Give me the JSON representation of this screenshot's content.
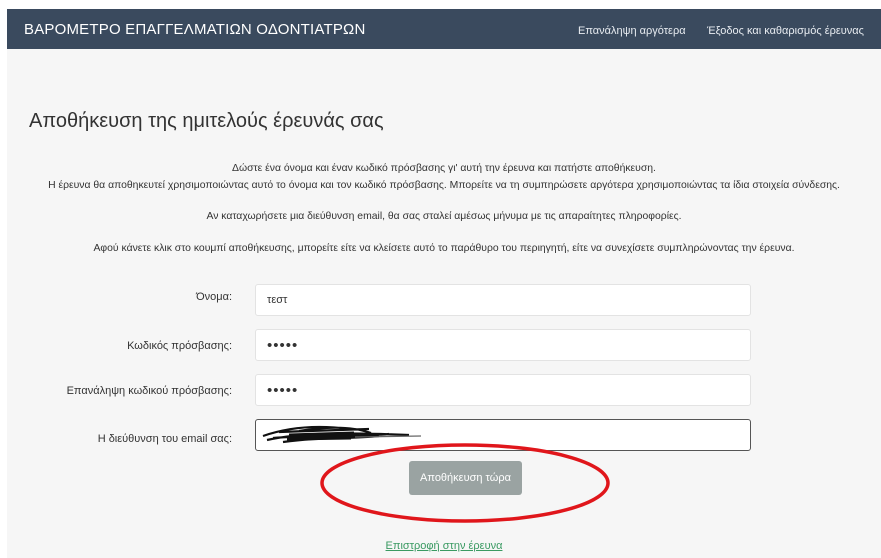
{
  "header": {
    "title": "ΒΑΡΟΜΕΤΡΟ ΕΠΑΓΓΕΛΜΑΤΙΩΝ ΟΔΟΝΤΙΑΤΡΩΝ",
    "resume_later": "Επανάληψη αργότερα",
    "exit_clear": "Έξοδος και καθαρισμός έρευνας"
  },
  "page": {
    "title": "Αποθήκευση της ημιτελούς έρευνάς σας",
    "intro": [
      "Δώστε ένα όνομα και έναν κωδικό πρόσβασης γι' αυτή την έρευνα και πατήστε αποθήκευση.",
      "Η έρευνα θα αποθηκευτεί χρησιμοποιώντας αυτό το όνομα και τον κωδικό πρόσβασης. Μπορείτε να τη συμπηρώσετε αργότερα χρησιμοποιώντας τα ίδια στοιχεία σύνδεσης.",
      "Αν καταχωρήσετε μια διεύθυνση email, θα σας σταλεί αμέσως μήνυμα με τις απαραίτητες πληροφορίες.",
      "Αφού κάνετε κλικ στο κουμπί αποθήκευσης, μπορείτε είτε να κλείσετε αυτό το παράθυρο του περιηγητή, είτε να συνεχίσετε συμπληρώνοντας την έρευνα."
    ]
  },
  "form": {
    "name_label": "Όνομα:",
    "name_value": "τεστ",
    "password_label": "Κωδικός πρόσβασης:",
    "password_value": "•••••",
    "repeat_label": "Επανάληψη κωδικού πρόσβασης:",
    "repeat_value": "•••••",
    "email_label": "Η διεύθυνση του email σας:",
    "save_button": "Αποθήκευση τώρα"
  },
  "footer": {
    "return_link": "Επιστροφή στην έρευνα"
  },
  "colors": {
    "header_bg": "#3a4a5e",
    "content_bg": "#f6f6f6",
    "button_bg": "#9aa3a2",
    "link": "#3a9a62",
    "annotation_ring": "#e0161b"
  }
}
